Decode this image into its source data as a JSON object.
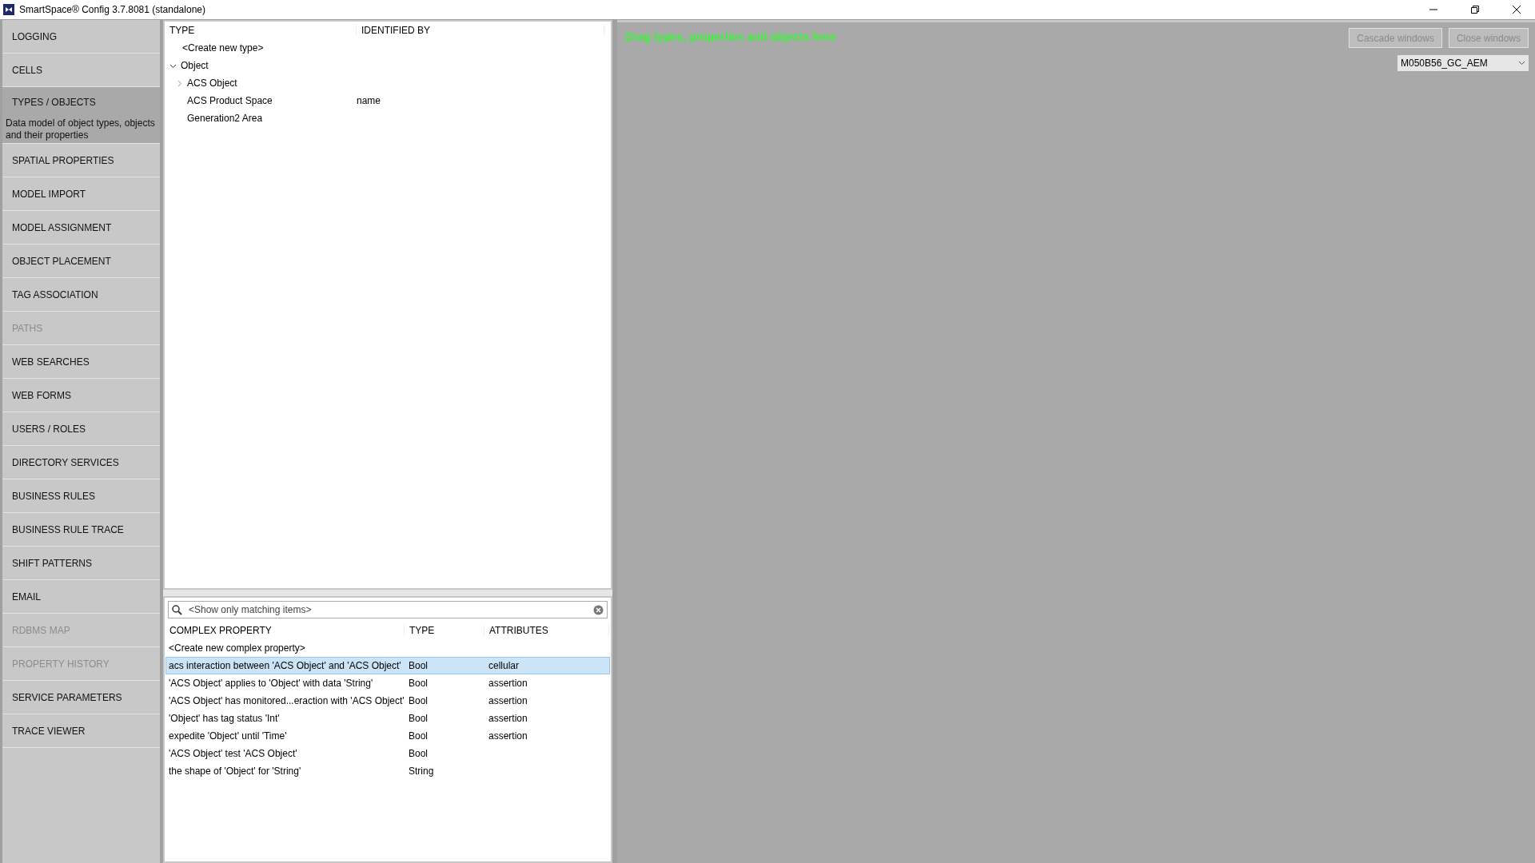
{
  "window": {
    "title": "SmartSpace® Config 3.7.8081 (standalone)"
  },
  "sidebar": {
    "items": [
      {
        "label": "LOGGING",
        "selected": false,
        "disabled": false
      },
      {
        "label": "CELLS",
        "selected": false,
        "disabled": false
      },
      {
        "label": "TYPES / OBJECTS",
        "selected": true,
        "disabled": false,
        "description": "Data model of object types, objects and their properties"
      },
      {
        "label": "SPATIAL PROPERTIES",
        "selected": false,
        "disabled": false
      },
      {
        "label": "MODEL IMPORT",
        "selected": false,
        "disabled": false
      },
      {
        "label": "MODEL ASSIGNMENT",
        "selected": false,
        "disabled": false
      },
      {
        "label": "OBJECT PLACEMENT",
        "selected": false,
        "disabled": false
      },
      {
        "label": "TAG ASSOCIATION",
        "selected": false,
        "disabled": false
      },
      {
        "label": "PATHS",
        "selected": false,
        "disabled": true
      },
      {
        "label": "WEB SEARCHES",
        "selected": false,
        "disabled": false
      },
      {
        "label": "WEB FORMS",
        "selected": false,
        "disabled": false
      },
      {
        "label": "USERS / ROLES",
        "selected": false,
        "disabled": false
      },
      {
        "label": "DIRECTORY SERVICES",
        "selected": false,
        "disabled": false
      },
      {
        "label": "BUSINESS RULES",
        "selected": false,
        "disabled": false
      },
      {
        "label": "BUSINESS RULE TRACE",
        "selected": false,
        "disabled": false
      },
      {
        "label": "SHIFT PATTERNS",
        "selected": false,
        "disabled": false
      },
      {
        "label": "EMAIL",
        "selected": false,
        "disabled": false
      },
      {
        "label": "RDBMS MAP",
        "selected": false,
        "disabled": true
      },
      {
        "label": "PROPERTY HISTORY",
        "selected": false,
        "disabled": true
      },
      {
        "label": "SERVICE PARAMETERS",
        "selected": false,
        "disabled": false
      },
      {
        "label": "TRACE VIEWER",
        "selected": false,
        "disabled": false
      }
    ]
  },
  "type_tree": {
    "columns": [
      "TYPE",
      "IDENTIFIED BY"
    ],
    "create_label": "<Create new type>",
    "items": [
      {
        "label": "Object",
        "expanded": true,
        "children": [
          {
            "label": "ACS Object",
            "expanded": false
          },
          {
            "label": "ACS Product Space",
            "identified_by": "name"
          },
          {
            "label": "Generation2 Area"
          }
        ]
      }
    ]
  },
  "property_filter": {
    "placeholder": "<Show only matching items>"
  },
  "property_table": {
    "columns": [
      "COMPLEX PROPERTY",
      "TYPE",
      "ATTRIBUTES"
    ],
    "create_label": "<Create new complex property>",
    "rows": [
      {
        "property": "acs interaction between 'ACS Object' and 'ACS Object'",
        "type": "Bool",
        "attributes": "cellular",
        "selected": true
      },
      {
        "property": "'ACS Object' applies to 'Object' with data 'String'",
        "type": "Bool",
        "attributes": "assertion",
        "selected": false
      },
      {
        "property": "'ACS Object' has monitored...eraction with 'ACS Object'",
        "type": "Bool",
        "attributes": "assertion",
        "selected": false
      },
      {
        "property": "'Object' has tag status 'Int'",
        "type": "Bool",
        "attributes": "assertion",
        "selected": false
      },
      {
        "property": "expedite 'Object' until 'Time'",
        "type": "Bool",
        "attributes": "assertion",
        "selected": false
      },
      {
        "property": "'ACS Object' test 'ACS Object'",
        "type": "Bool",
        "selected": false
      },
      {
        "property": "the shape of 'Object' for 'String'",
        "type": "String",
        "selected": false
      }
    ]
  },
  "canvas": {
    "hint": "Drag types, properties and objects here",
    "buttons": [
      {
        "label": "Cascade windows",
        "disabled": true
      },
      {
        "label": "Close windows",
        "disabled": true
      }
    ],
    "model_select": {
      "value": "M050B56_GC_AEM"
    }
  }
}
